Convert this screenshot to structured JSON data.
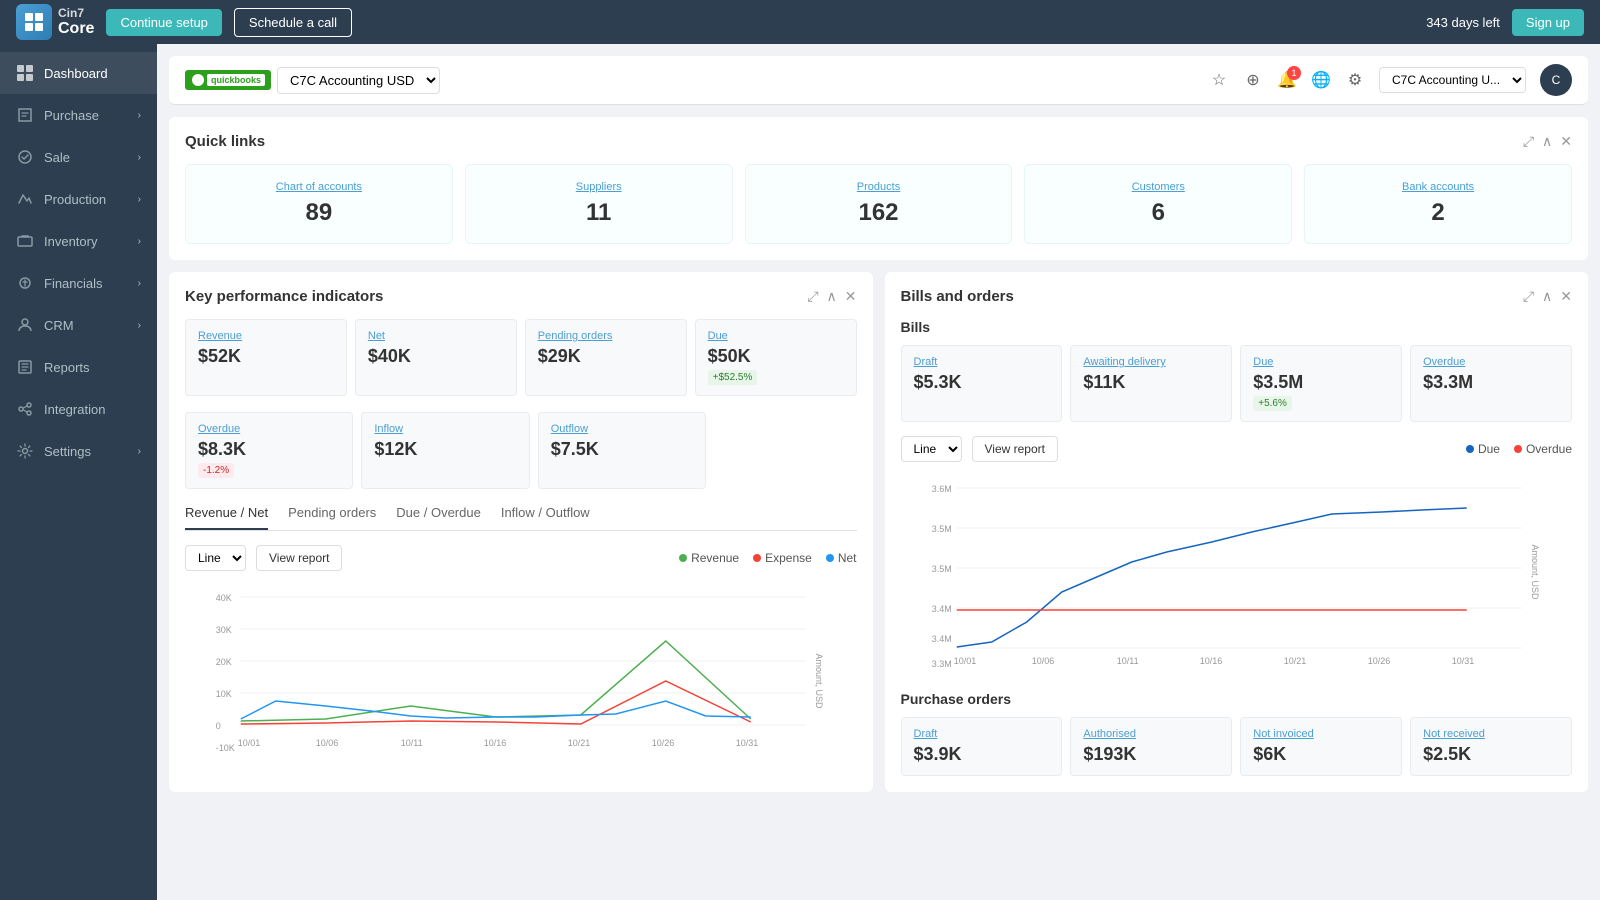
{
  "topbar": {
    "logo_cin7": "Cin7",
    "logo_core": "Core",
    "btn_continue": "Continue setup",
    "btn_schedule": "Schedule a call",
    "days_left": "343 days left",
    "btn_signup": "Sign up"
  },
  "sidebar": {
    "items": [
      {
        "label": "Dashboard",
        "icon": "dashboard-icon",
        "active": true,
        "has_chevron": false
      },
      {
        "label": "Purchase",
        "icon": "purchase-icon",
        "active": false,
        "has_chevron": true
      },
      {
        "label": "Sale",
        "icon": "sale-icon",
        "active": false,
        "has_chevron": true
      },
      {
        "label": "Production",
        "icon": "production-icon",
        "active": false,
        "has_chevron": true
      },
      {
        "label": "Inventory",
        "icon": "inventory-icon",
        "active": false,
        "has_chevron": true
      },
      {
        "label": "Financials",
        "icon": "financials-icon",
        "active": false,
        "has_chevron": true
      },
      {
        "label": "CRM",
        "icon": "crm-icon",
        "active": false,
        "has_chevron": true
      },
      {
        "label": "Reports",
        "icon": "reports-icon",
        "active": false,
        "has_chevron": false
      },
      {
        "label": "Integration",
        "icon": "integration-icon",
        "active": false,
        "has_chevron": false
      },
      {
        "label": "Settings",
        "icon": "settings-icon",
        "active": false,
        "has_chevron": true
      }
    ]
  },
  "header": {
    "qb_label": "quickbooks",
    "company": "C7C Accounting USD",
    "notification_count": "1",
    "company_dropdown": "C7C Accounting U..."
  },
  "quick_links": {
    "title": "Quick links",
    "items": [
      {
        "label": "Chart of accounts",
        "value": "89"
      },
      {
        "label": "Suppliers",
        "value": "11"
      },
      {
        "label": "Products",
        "value": "162"
      },
      {
        "label": "Customers",
        "value": "6"
      },
      {
        "label": "Bank accounts",
        "value": "2"
      }
    ]
  },
  "kpi": {
    "title": "Key performance indicators",
    "metrics_row1": [
      {
        "label": "Revenue",
        "value": "$52K",
        "badge": null
      },
      {
        "label": "Net",
        "value": "$40K",
        "badge": null
      },
      {
        "label": "Pending orders",
        "value": "$29K",
        "badge": null
      },
      {
        "label": "Due",
        "value": "$50K",
        "badge": "+$52.5%",
        "badge_type": "green"
      }
    ],
    "metrics_row2": [
      {
        "label": "Overdue",
        "value": "$8.3K",
        "badge": "-1.2%",
        "badge_type": "red"
      },
      {
        "label": "Inflow",
        "value": "$12K",
        "badge": null
      },
      {
        "label": "Outflow",
        "value": "$7.5K",
        "badge": null
      }
    ],
    "tabs": [
      "Revenue / Net",
      "Pending orders",
      "Due / Overdue",
      "Inflow / Outflow"
    ],
    "active_tab": "Revenue / Net",
    "chart_type": "Line",
    "btn_view_report": "View report",
    "legend": [
      {
        "label": "Revenue",
        "color": "#4caf50"
      },
      {
        "label": "Expense",
        "color": "#f44336"
      },
      {
        "label": "Net",
        "color": "#2196f3"
      }
    ],
    "x_labels": [
      "10/01",
      "10/06",
      "10/11",
      "10/16",
      "10/21",
      "10/26",
      "10/31"
    ],
    "y_labels": [
      "40K",
      "30K",
      "20K",
      "10K",
      "0",
      "-10K"
    ],
    "y_axis_label": "Amount, USD"
  },
  "bills_orders": {
    "title": "Bills and orders",
    "bills_section": "Bills",
    "bills_metrics": [
      {
        "label": "Draft",
        "value": "$5.3K",
        "badge": null
      },
      {
        "label": "Awaiting delivery",
        "value": "$11K",
        "badge": null
      },
      {
        "label": "Due",
        "value": "$3.5M",
        "badge": "+5.6%",
        "badge_type": "green"
      },
      {
        "label": "Overdue",
        "value": "$3.3M",
        "badge": null
      }
    ],
    "chart_type": "Line",
    "btn_view_report": "View report",
    "legend": [
      {
        "label": "Due",
        "color": "#1565c0"
      },
      {
        "label": "Overdue",
        "color": "#f44336"
      }
    ],
    "x_labels": [
      "10/01",
      "10/06",
      "10/11",
      "10/16",
      "10/21",
      "10/26",
      "10/31"
    ],
    "y_labels": [
      "3.6M",
      "3.5M",
      "3.5M",
      "3.4M",
      "3.4M",
      "3.3M"
    ],
    "y_axis_label": "Amount, USD",
    "purchase_orders_section": "Purchase orders",
    "po_metrics": [
      {
        "label": "Draft",
        "value": "$3.9K"
      },
      {
        "label": "Authorised",
        "value": "$193K"
      },
      {
        "label": "Not invoiced",
        "value": "$6K"
      },
      {
        "label": "Not received",
        "value": "$2.5K"
      }
    ]
  }
}
